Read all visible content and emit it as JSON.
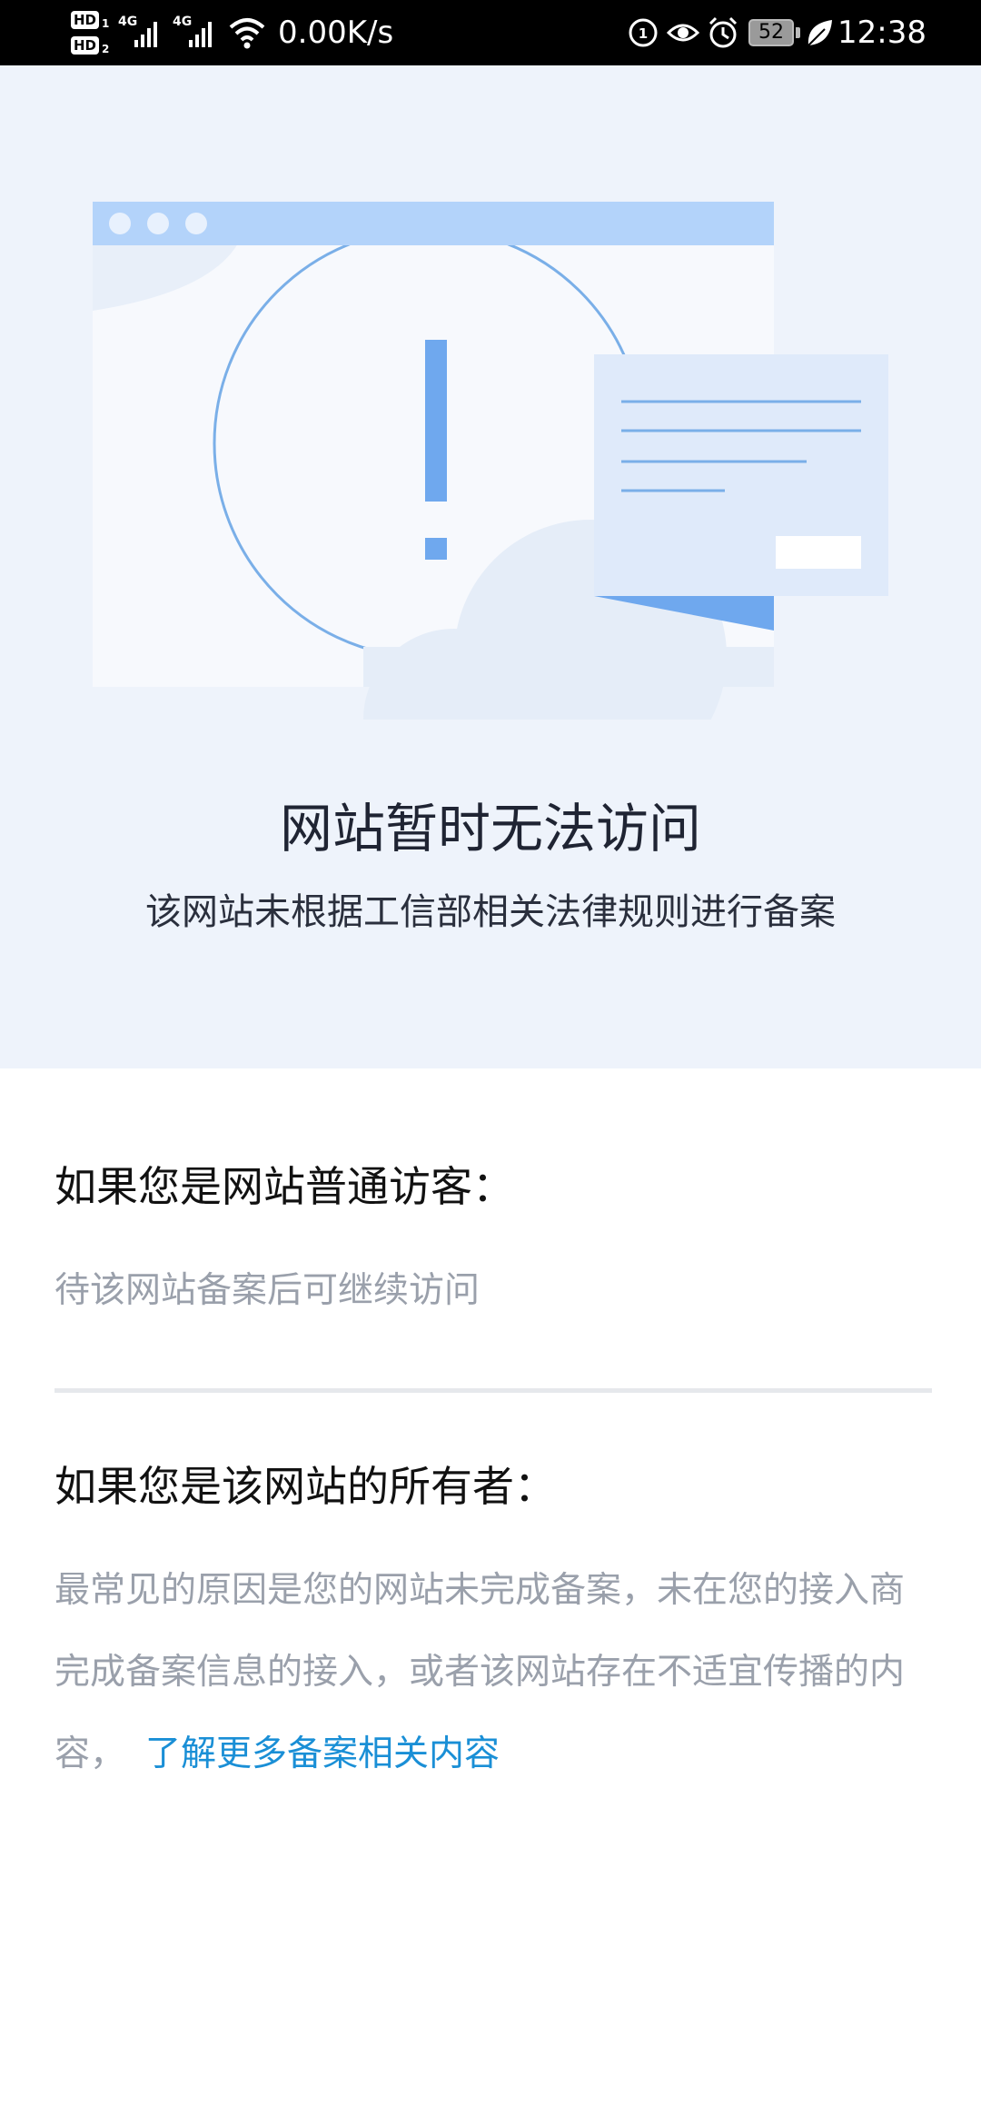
{
  "status_bar": {
    "hd1": "HD",
    "hd1_sub": "1",
    "hd2": "HD",
    "hd2_sub": "2",
    "signal1_tag": "4G",
    "signal2_tag": "4G",
    "network_speed": "0.00K/s",
    "battery_level": "52",
    "time": "12:38",
    "icons": [
      "sim-1-icon",
      "eye-icon",
      "alarm-icon",
      "battery-icon",
      "leaf-icon",
      "wifi-icon",
      "signal-icon"
    ]
  },
  "hero": {
    "title": "网站暂时无法访问",
    "subtitle": "该网站未根据工信部相关法律规则进行备案"
  },
  "visitor": {
    "heading": "如果您是网站普通访客：",
    "text": "待该网站备案后可继续访问"
  },
  "owner": {
    "heading": "如果您是该网站的所有者：",
    "text": "最常见的原因是您的网站未完成备案，未在您的接入商完成备案信息的接入，或者该网站存在不适宜传播的内容，",
    "link_text": "了解更多备案相关内容"
  },
  "colors": {
    "hero_background": "#eef3fb",
    "accent_blue": "#6fa8ee",
    "link_blue": "#1a8fd6",
    "muted_text": "#9aa0ab"
  }
}
